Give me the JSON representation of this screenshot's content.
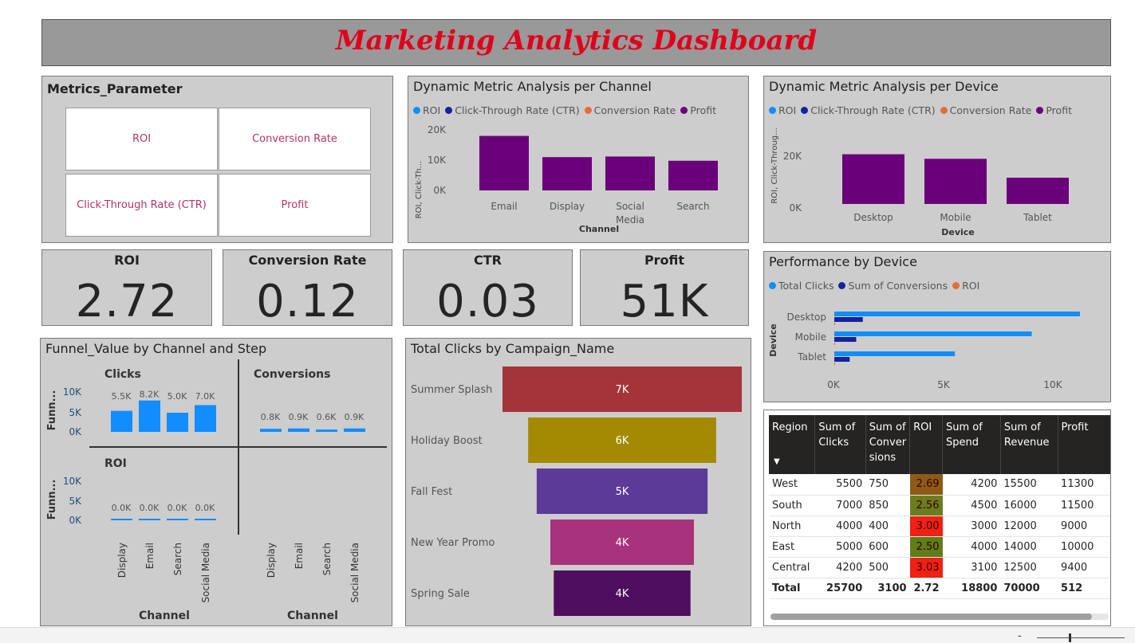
{
  "title": "Marketing Analytics Dashboard",
  "metrics_parameter": {
    "title": "Metrics_Parameter",
    "options": [
      "ROI",
      "Conversion Rate",
      "Click-Through Rate (CTR)",
      "Profit"
    ]
  },
  "legend_metrics": [
    {
      "label": "ROI",
      "color": "#118dff"
    },
    {
      "label": "Click-Through Rate (CTR)",
      "color": "#12239e"
    },
    {
      "label": "Conversion Rate",
      "color": "#e66c37"
    },
    {
      "label": "Profit",
      "color": "#6b007b"
    }
  ],
  "kpis": [
    {
      "title": "ROI",
      "value": "2.72"
    },
    {
      "title": "Conversion Rate",
      "value": "0.12"
    },
    {
      "title": "CTR",
      "value": "0.03"
    },
    {
      "title": "Profit",
      "value": "51K"
    }
  ],
  "channel_chart": {
    "title": "Dynamic Metric Analysis per Channel",
    "ylabel": "ROI, Click-Th...",
    "xlabel": "Channel",
    "yticks": [
      "20K",
      "10K",
      "0K"
    ],
    "chart_data": {
      "type": "bar",
      "categories": [
        "Email",
        "Display",
        "Social Media",
        "Search"
      ],
      "values": [
        18000,
        11000,
        11200,
        9800
      ],
      "ylim": [
        0,
        20000
      ]
    }
  },
  "device_chart": {
    "title": "Dynamic Metric Analysis per Device",
    "ylabel": "ROI, Click-Throug...",
    "xlabel": "Device",
    "yticks": [
      "20K",
      "0K"
    ],
    "chart_data": {
      "type": "bar",
      "categories": [
        "Desktop",
        "Mobile",
        "Tablet"
      ],
      "values": [
        20800,
        18900,
        11000
      ],
      "ylim": [
        0,
        20000
      ]
    }
  },
  "perf_device": {
    "title": "Performance by Device",
    "legend": [
      {
        "label": "Total Clicks",
        "color": "#118dff"
      },
      {
        "label": "Sum of Conversions",
        "color": "#12239e"
      },
      {
        "label": "ROI",
        "color": "#e66c37"
      }
    ],
    "ylabel": "Device",
    "xticks": [
      "0K",
      "5K",
      "10K"
    ],
    "chart_data": {
      "type": "bar",
      "categories": [
        "Desktop",
        "Mobile",
        "Tablet"
      ],
      "series": [
        {
          "name": "Total Clicks",
          "values": [
            11200,
            9000,
            5500
          ]
        },
        {
          "name": "Sum of Conversions",
          "values": [
            1300,
            1000,
            700
          ]
        },
        {
          "name": "ROI",
          "values": [
            2.7,
            2.7,
            2.7
          ]
        }
      ],
      "xlim": [
        0,
        12000
      ]
    }
  },
  "funnel_value": {
    "title": "Funnel_Value by Channel and Step",
    "ylabel": "Funn...",
    "xlabel": "Channel",
    "panels": {
      "clicks": "Clicks",
      "conversions": "Conversions",
      "roi": "ROI"
    },
    "yticks": [
      "10K",
      "5K",
      "0K"
    ],
    "categories": [
      "Display",
      "Email",
      "Search",
      "Social Media"
    ],
    "chart_data": {
      "type": "bar",
      "categories": [
        "Display",
        "Email",
        "Search",
        "Social Media"
      ],
      "series": [
        {
          "name": "Clicks",
          "values": [
            5500,
            8200,
            5000,
            7000
          ],
          "labels": [
            "5.5K",
            "8.2K",
            "5.0K",
            "7.0K"
          ]
        },
        {
          "name": "Conversions",
          "values": [
            800,
            900,
            600,
            900
          ],
          "labels": [
            "0.8K",
            "0.9K",
            "0.6K",
            "0.9K"
          ]
        },
        {
          "name": "ROI",
          "values": [
            2.69,
            2.56,
            3.03,
            2.5
          ],
          "labels": [
            "0.0K",
            "0.0K",
            "0.0K",
            "0.0K"
          ]
        }
      ],
      "ylim": [
        0,
        10000
      ]
    }
  },
  "campaign_chart": {
    "title": "Total Clicks by Campaign_Name",
    "chart_data": {
      "type": "bar",
      "categories": [
        "Summer Splash",
        "Holiday Boost",
        "Fall Fest",
        "New Year Promo",
        "Spring Sale"
      ],
      "values": [
        7000,
        6000,
        5000,
        4000,
        4000
      ],
      "labels": [
        "7K",
        "6K",
        "5K",
        "4K",
        "4K"
      ],
      "raw_width": [
        7000,
        5500,
        5000,
        4200,
        4000
      ],
      "colors": [
        "#a4343a",
        "#a38a00",
        "#5b3b97",
        "#a8327b",
        "#4e0d5e"
      ]
    }
  },
  "table": {
    "headers": [
      "Region",
      "Sum of Clicks",
      "Sum of Conver sions",
      "ROI",
      "Sum of Spend",
      "Sum of Revenue",
      "Profit"
    ],
    "rows": [
      [
        "West",
        "5500",
        "750",
        "2.69",
        "4200",
        "15500",
        "11300"
      ],
      [
        "South",
        "7000",
        "850",
        "2.56",
        "4500",
        "16000",
        "11500"
      ],
      [
        "North",
        "4000",
        "400",
        "3.00",
        "3000",
        "12000",
        "9000"
      ],
      [
        "East",
        "5000",
        "600",
        "2.50",
        "4000",
        "14000",
        "10000"
      ],
      [
        "Central",
        "4200",
        "500",
        "3.03",
        "3100",
        "12500",
        "9400"
      ]
    ],
    "roi_colors": [
      "#8f5a12",
      "#6b7d1f",
      "#ef2014",
      "#5f7d18",
      "#ef2014"
    ],
    "total": [
      "Total",
      "25700",
      "3100",
      "2.72",
      "18800",
      "70000",
      "512"
    ]
  }
}
